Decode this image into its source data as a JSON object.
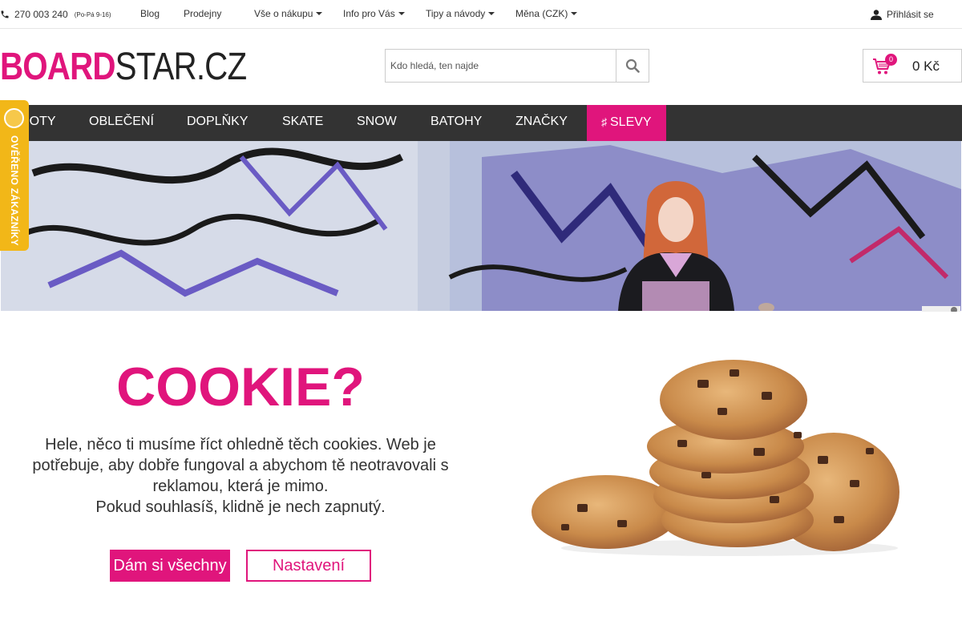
{
  "topbar": {
    "phone": "270 003 240",
    "hours": "(Po-Pá 9-16)",
    "links": [
      "Blog",
      "Prodejny"
    ],
    "dropdowns": [
      "Vše o nákupu",
      "Info pro Vás",
      "Tipy a návody",
      "Měna (CZK)"
    ],
    "login": "Přihlásit se"
  },
  "header": {
    "logo_bold": "BOARD",
    "logo_light": "STAR.CZ",
    "search_placeholder": "Kdo hledá, ten najde",
    "cart_count": "0",
    "cart_total": "0 Kč"
  },
  "nav": {
    "items": [
      "BOTY",
      "OBLEČENÍ",
      "DOPLŇKY",
      "SKATE",
      "SNOW",
      "BATOHY",
      "ZNAČKY"
    ],
    "sale": "SLEVY"
  },
  "verified_badge": "OVĚŘENO ZÁKAZNÍKY",
  "cookie": {
    "title": "COOKIE?",
    "text1": "Hele, něco ti musíme říct ohledně těch cookies. Web je potřebuje, aby dobře fungoval a abychom tě neotravovali s reklamou, která je mimo.",
    "text2": "Pokud souhlasíš, klidně je nech zapnutý.",
    "accept": "Dám si všechny",
    "settings": "Nastavení"
  },
  "colors": {
    "brand": "#e0157c",
    "nav_bg": "#333333",
    "badge": "#f2b718"
  },
  "icons": [
    "phone-icon",
    "user-icon",
    "search-icon",
    "cart-icon",
    "tag-icon",
    "caret-down-icon"
  ]
}
